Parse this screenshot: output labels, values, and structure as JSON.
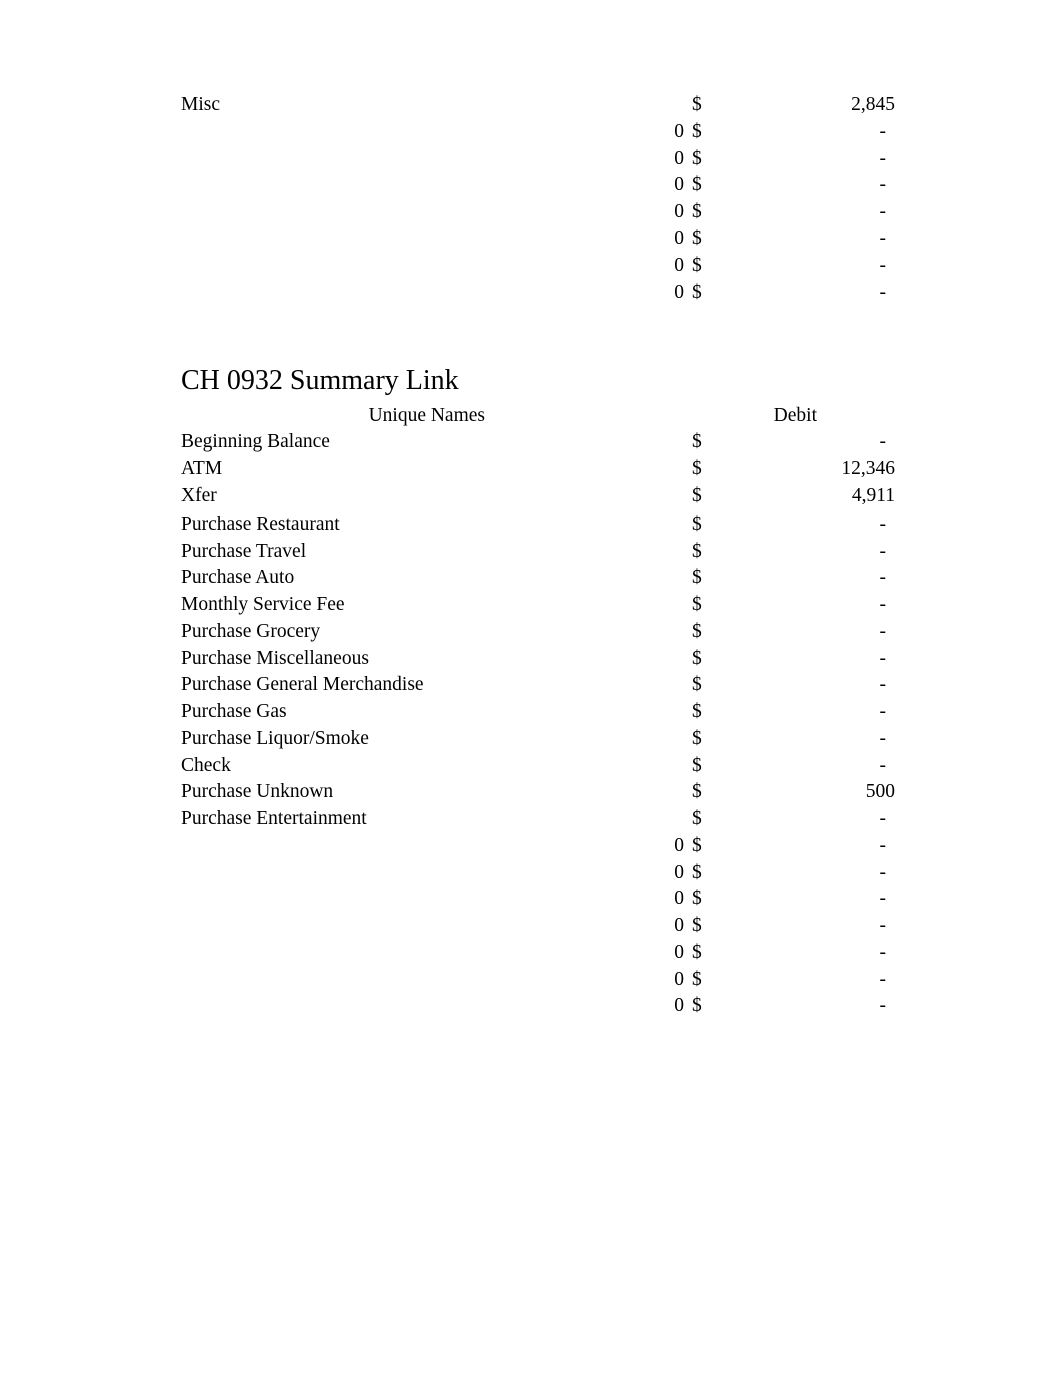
{
  "document": {
    "page_background": "#ffffff",
    "text_color": "#000000"
  },
  "top_block": {
    "rows": [
      {
        "label": "Misc",
        "zero": "",
        "currency": "$",
        "value": "2,845"
      },
      {
        "label": "",
        "zero": "0",
        "currency": "$",
        "value": "-"
      },
      {
        "label": "",
        "zero": "0",
        "currency": "$",
        "value": "-"
      },
      {
        "label": "",
        "zero": "0",
        "currency": "$",
        "value": "-"
      },
      {
        "label": "",
        "zero": "0",
        "currency": "$",
        "value": "-"
      },
      {
        "label": "",
        "zero": "0",
        "currency": "$",
        "value": "-"
      },
      {
        "label": "",
        "zero": "0",
        "currency": "$",
        "value": "-"
      },
      {
        "label": "",
        "zero": "0",
        "currency": "$",
        "value": "-"
      }
    ]
  },
  "summary_section": {
    "title": "CH 0932 Summary Link",
    "headers": {
      "names": "Unique Names",
      "debit": "Debit"
    },
    "rows": [
      {
        "label": "Beginning Balance",
        "zero": "",
        "currency": "$",
        "value": "-"
      },
      {
        "label": "ATM",
        "zero": "",
        "currency": "$",
        "value": "12,346"
      },
      {
        "label": "Xfer",
        "zero": "",
        "currency": "$",
        "value": "4,911"
      },
      {
        "label": "Purchase Restaurant",
        "zero": "",
        "currency": "$",
        "value": "-"
      },
      {
        "label": "Purchase Travel",
        "zero": "",
        "currency": "$",
        "value": "-"
      },
      {
        "label": "Purchase Auto",
        "zero": "",
        "currency": "$",
        "value": "-"
      },
      {
        "label": "Monthly Service Fee",
        "zero": "",
        "currency": "$",
        "value": "-"
      },
      {
        "label": "Purchase Grocery",
        "zero": "",
        "currency": "$",
        "value": "-"
      },
      {
        "label": "Purchase Miscellaneous",
        "zero": "",
        "currency": "$",
        "value": "-"
      },
      {
        "label": "Purchase General Merchandise",
        "zero": "",
        "currency": "$",
        "value": "-"
      },
      {
        "label": "Purchase Gas",
        "zero": "",
        "currency": "$",
        "value": "-"
      },
      {
        "label": "Purchase Liquor/Smoke",
        "zero": "",
        "currency": "$",
        "value": "-"
      },
      {
        "label": "Check",
        "zero": "",
        "currency": "$",
        "value": "-"
      },
      {
        "label": "Purchase Unknown",
        "zero": "",
        "currency": "$",
        "value": "500"
      },
      {
        "label": "Purchase Entertainment",
        "zero": "",
        "currency": "$",
        "value": "-"
      },
      {
        "label": "",
        "zero": "0",
        "currency": "$",
        "value": "-"
      },
      {
        "label": "",
        "zero": "0",
        "currency": "$",
        "value": "-"
      },
      {
        "label": "",
        "zero": "0",
        "currency": "$",
        "value": "-"
      },
      {
        "label": "",
        "zero": "0",
        "currency": "$",
        "value": "-"
      },
      {
        "label": "",
        "zero": "0",
        "currency": "$",
        "value": "-"
      },
      {
        "label": "",
        "zero": "0",
        "currency": "$",
        "value": "-"
      },
      {
        "label": "",
        "zero": "0",
        "currency": "$",
        "value": "-"
      }
    ]
  }
}
